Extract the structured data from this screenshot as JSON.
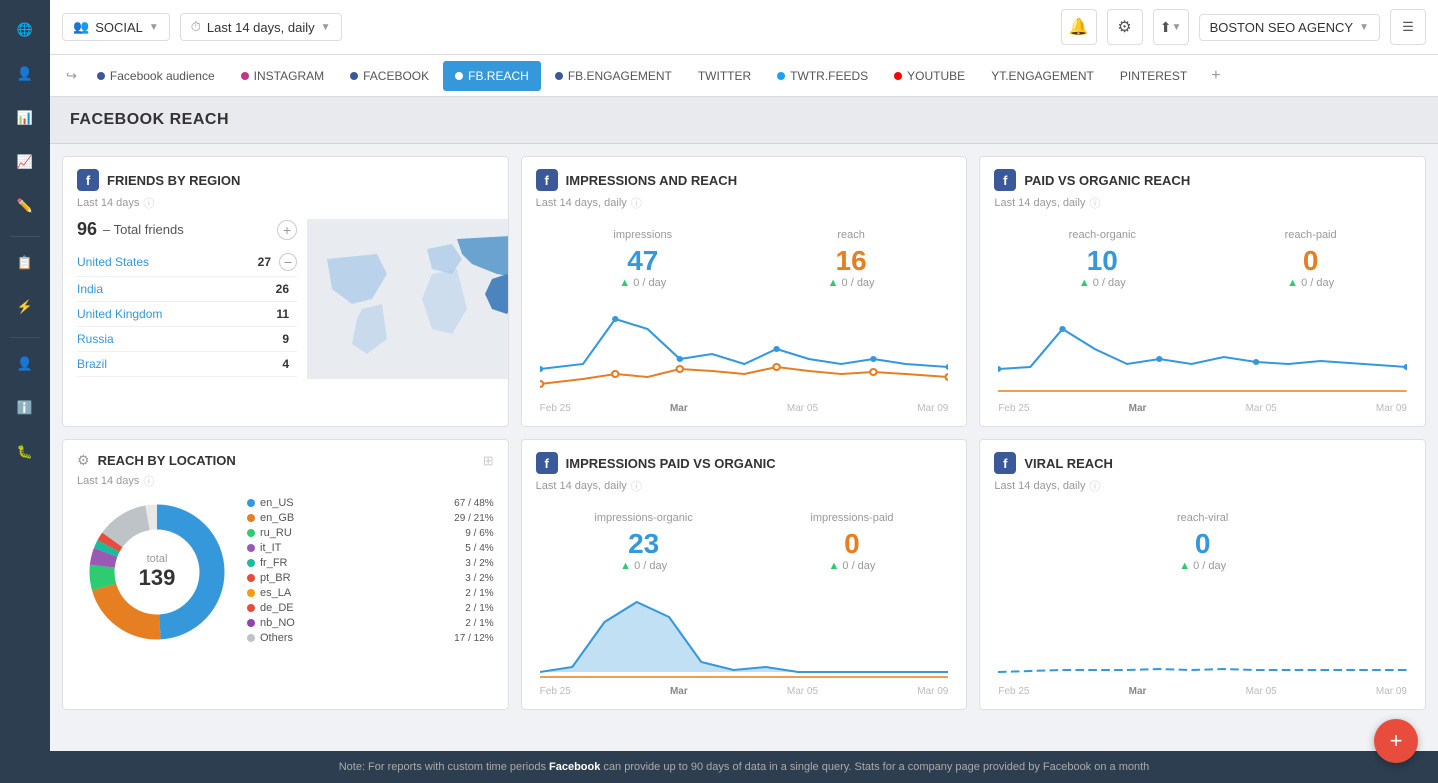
{
  "sidebar": {
    "items": [
      {
        "name": "globe-icon",
        "icon": "🌐"
      },
      {
        "name": "people-icon",
        "icon": "👤"
      },
      {
        "name": "chart-icon",
        "icon": "📊"
      },
      {
        "name": "trending-icon",
        "icon": "📈"
      },
      {
        "name": "edit-icon",
        "icon": "✏️"
      },
      {
        "name": "clipboard-icon",
        "icon": "📋"
      },
      {
        "name": "lightning-icon",
        "icon": "⚡"
      },
      {
        "name": "user-icon",
        "icon": "👤"
      },
      {
        "name": "info-icon",
        "icon": "ℹ️"
      },
      {
        "name": "bug-icon",
        "icon": "🐛"
      }
    ]
  },
  "topbar": {
    "social_label": "SOCIAL",
    "date_label": "Last 14 days, daily",
    "agency_label": "BOSTON SEO AGENCY",
    "menu_icon": "☰"
  },
  "tabs": [
    {
      "label": "Facebook audience",
      "dot_color": "#3b5998",
      "active": false
    },
    {
      "label": "INSTAGRAM",
      "dot_color": "#c13584",
      "active": false
    },
    {
      "label": "FACEBOOK",
      "dot_color": "#3b5998",
      "active": false
    },
    {
      "label": "FB.REACH",
      "dot_color": "#3b5998",
      "active": true
    },
    {
      "label": "FB.ENGAGEMENT",
      "dot_color": "#3b5998",
      "active": false
    },
    {
      "label": "TWITTER",
      "dot_color": "#1da1f2",
      "active": false
    },
    {
      "label": "TWTR.FEEDS",
      "dot_color": "#1da1f2",
      "active": false
    },
    {
      "label": "YOUTUBE",
      "dot_color": "#ff0000",
      "active": false
    },
    {
      "label": "YT.ENGAGEMENT",
      "active": false
    },
    {
      "label": "PINTEREST",
      "active": false
    }
  ],
  "page_title": "FACEBOOK REACH",
  "friends_by_region": {
    "title": "FRIENDS BY REGION",
    "subtitle": "Last 14 days",
    "total_label": "Total friends",
    "total": "96",
    "countries": [
      {
        "name": "United States",
        "count": "27"
      },
      {
        "name": "India",
        "count": "26"
      },
      {
        "name": "United Kingdom",
        "count": "11"
      },
      {
        "name": "Russia",
        "count": "9"
      },
      {
        "name": "Brazil",
        "count": "4"
      }
    ]
  },
  "impressions_reach": {
    "title": "IMPRESSIONS AND REACH",
    "subtitle": "Last 14 days, daily",
    "impressions_label": "impressions",
    "impressions_value": "47",
    "impressions_delta": "▲0 / day",
    "reach_label": "reach",
    "reach_value": "16",
    "reach_delta": "▲0 / day",
    "x_labels": [
      "Feb 25",
      "Mar",
      "Mar 05",
      "Mar 09"
    ]
  },
  "paid_organic": {
    "title": "PAID VS ORGANIC REACH",
    "subtitle": "Last 14 days, daily",
    "organic_label": "reach-organic",
    "organic_value": "10",
    "organic_delta": "▲0 / day",
    "paid_label": "reach-paid",
    "paid_value": "0",
    "paid_delta": "▲0 / day",
    "x_labels": [
      "Feb 25",
      "Mar",
      "Mar 05",
      "Mar 09"
    ]
  },
  "reach_location": {
    "title": "REACH BY LOCATION",
    "subtitle": "Last 14 days",
    "total_word": "total",
    "total_num": "139",
    "legend": [
      {
        "name": "en_US",
        "value": "67 / 48%",
        "color": "#3498db"
      },
      {
        "name": "en_GB",
        "value": "29 / 21%",
        "color": "#e67e22"
      },
      {
        "name": "ru_RU",
        "value": "9 / 6%",
        "color": "#2ecc71"
      },
      {
        "name": "it_IT",
        "value": "5 / 4%",
        "color": "#9b59b6"
      },
      {
        "name": "fr_FR",
        "value": "3 / 2%",
        "color": "#1abc9c"
      },
      {
        "name": "pt_BR",
        "value": "3 / 2%",
        "color": "#e74c3c"
      },
      {
        "name": "es_LA",
        "value": "2 / 1%",
        "color": "#f39c12"
      },
      {
        "name": "de_DE",
        "value": "2 / 1%",
        "color": "#e74c3c"
      },
      {
        "name": "nb_NO",
        "value": "2 / 1%",
        "color": "#8e44ad"
      },
      {
        "name": "Others",
        "value": "17 / 12%",
        "color": "#bdc3c7"
      }
    ]
  },
  "impressions_paid_organic": {
    "title": "IMPRESSIONS PAID VS ORGANIC",
    "subtitle": "Last 14 days, daily",
    "organic_label": "impressions-organic",
    "organic_value": "23",
    "organic_delta": "▲0 / day",
    "paid_label": "impressions-paid",
    "paid_value": "0",
    "paid_delta": "▲0 / day",
    "x_labels": [
      "Feb 25",
      "Mar",
      "Mar 05",
      "Mar 09"
    ]
  },
  "viral_reach": {
    "title": "VIRAL REACH",
    "subtitle": "Last 14 days, daily",
    "viral_label": "reach-viral",
    "viral_value": "0",
    "viral_delta": "▲0 / day",
    "x_labels": [
      "Feb 25",
      "Mar",
      "Mar 05",
      "Mar 09"
    ]
  },
  "bottom_note": {
    "prefix": "Note: For reports with custom time periods ",
    "brand": "Facebook",
    "suffix": " can provide up to 90 days of data in a single query. Stats for a company page provided by Facebook on a month"
  },
  "fab_icon": "+"
}
